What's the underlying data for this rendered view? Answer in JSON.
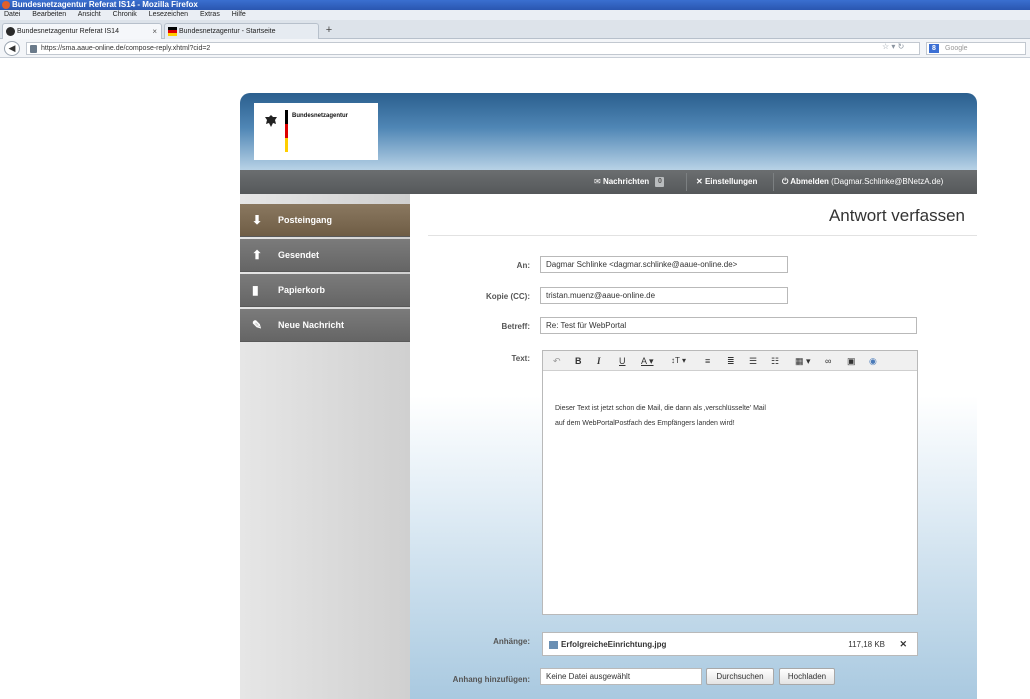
{
  "browser": {
    "window_title": "Bundesnetzagentur Referat IS14 - Mozilla Firefox",
    "menu": [
      "Datei",
      "Bearbeiten",
      "Ansicht",
      "Chronik",
      "Lesezeichen",
      "Extras",
      "Hilfe"
    ],
    "tabs": [
      {
        "label": "Bundesnetzagentur Referat IS14"
      },
      {
        "label": "Bundesnetzagentur - Startseite"
      }
    ],
    "url": "https://sma.aaue-online.de/compose-reply.xhtml?cid=2",
    "search_placeholder": "Google",
    "search_engine_glyph": "8"
  },
  "app": {
    "logo_text": "Bundesnetzagentur",
    "nav": {
      "messages": "Nachrichten",
      "messages_count": "0",
      "settings": "Einstellungen",
      "logout": "Abmelden",
      "logout_user": "(Dagmar.Schlinke@BNetzA.de)"
    },
    "sidebar": [
      {
        "label": "Posteingang"
      },
      {
        "label": "Gesendet"
      },
      {
        "label": "Papierkorb"
      },
      {
        "label": "Neue Nachricht"
      }
    ],
    "colors": {
      "accent": "#6f5d45",
      "header": "#2b5f8e",
      "nav": "#5f6264"
    }
  },
  "compose": {
    "title": "Antwort verfassen",
    "to_label": "An:",
    "to_value": "Dagmar Schlinke <dagmar.schlinke@aaue-online.de>",
    "cc_label": "Kopie (CC):",
    "cc_value": "tristan.muenz@aaue-online.de",
    "subject_label": "Betreff:",
    "subject_value": "Re: Test für WebPortal",
    "text_label": "Text:",
    "body_line1": "Dieser Text ist jetzt schon die Mail, die dann als ‚verschlüsselte' Mail",
    "body_line2": "auf dem WebPortalPostfach des Empfängers landen wird!",
    "attachments_label": "Anhänge:",
    "attachment_name": "ErfolgreicheEinrichtung.jpg",
    "attachment_size": "117,18 KB",
    "add_attachment_label": "Anhang hinzufügen:",
    "file_value": "Keine Datei ausgewählt",
    "browse_button": "Durchsuchen",
    "upload_button": "Hochladen"
  }
}
